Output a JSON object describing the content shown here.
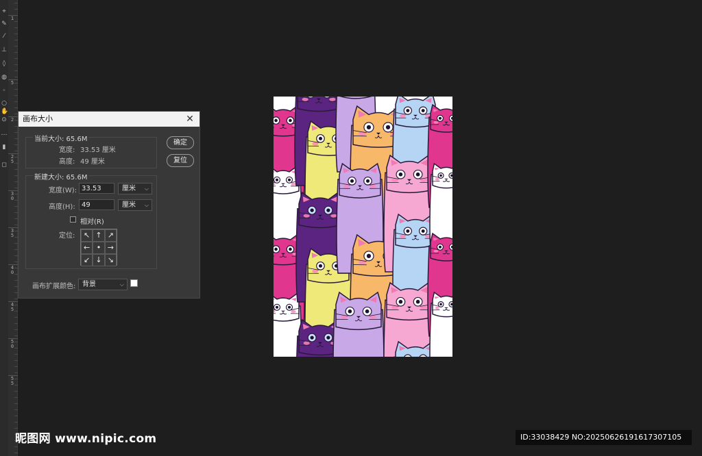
{
  "tools": [
    {
      "icon": "lasso-icon",
      "glyph": "⌖"
    },
    {
      "icon": "pen-icon",
      "glyph": "✎"
    },
    {
      "icon": "brush-icon",
      "glyph": "⁄"
    },
    {
      "icon": "stamp-icon",
      "glyph": "⊥"
    },
    {
      "icon": "eraser-icon",
      "glyph": "◊"
    },
    {
      "icon": "bucket-icon",
      "glyph": "◍"
    },
    {
      "icon": "blur-icon",
      "glyph": "◦"
    },
    {
      "icon": "dodge-icon",
      "glyph": "○"
    },
    {
      "icon": "hand-icon",
      "glyph": "✋"
    },
    {
      "icon": "zoom-icon",
      "glyph": "⊙"
    },
    {
      "icon": "more-icon",
      "glyph": "…"
    },
    {
      "icon": "foreground-background-icon",
      "glyph": "▮"
    },
    {
      "icon": "quick-mask-icon",
      "glyph": "◻"
    }
  ],
  "ruler_labels": [
    "1",
    "5",
    "2",
    "2 5",
    "3 0",
    "3 5",
    "4 0",
    "4 5",
    "5 0",
    "5 5"
  ],
  "dialog": {
    "title": "画布大小",
    "current": {
      "legend": "当前大小: 65.6M",
      "width_label": "宽度:",
      "width_value": "33.53 厘米",
      "height_label": "高度:",
      "height_value": "49 厘米"
    },
    "new_size": {
      "legend": "新建大小: 65.6M",
      "width_label": "宽度(W):",
      "width_value": "33.53",
      "width_unit": "厘米",
      "height_label": "高度(H):",
      "height_value": "49",
      "height_unit": "厘米",
      "relative_label": "相对(R)",
      "relative_checked": false,
      "anchor_label": "定位:",
      "anchor_glyphs": [
        "↖",
        "↑",
        "↗",
        "←",
        "•",
        "→",
        "↙",
        "↓",
        "↘"
      ]
    },
    "buttons": {
      "ok": "确定",
      "reset": "复位"
    },
    "extension_color_label": "画布扩展颜色:",
    "extension_color_value": "背景",
    "extension_swatch_color": "#ffffff"
  },
  "watermark": {
    "site_text": "昵图网 www.nipic.com",
    "id_text": "ID:33038429 NO:20250626191617307105"
  },
  "colors": {
    "background": "#1e1e1e",
    "dialog": "#383838",
    "magenta": "#e1368e",
    "purple": "#5b2480",
    "yellow": "#efe97a",
    "orange": "#f7b86a",
    "lilac": "#c9a8e8",
    "pink": "#f6a8d2",
    "sky": "#b6d4f4",
    "white": "#ffffff"
  }
}
